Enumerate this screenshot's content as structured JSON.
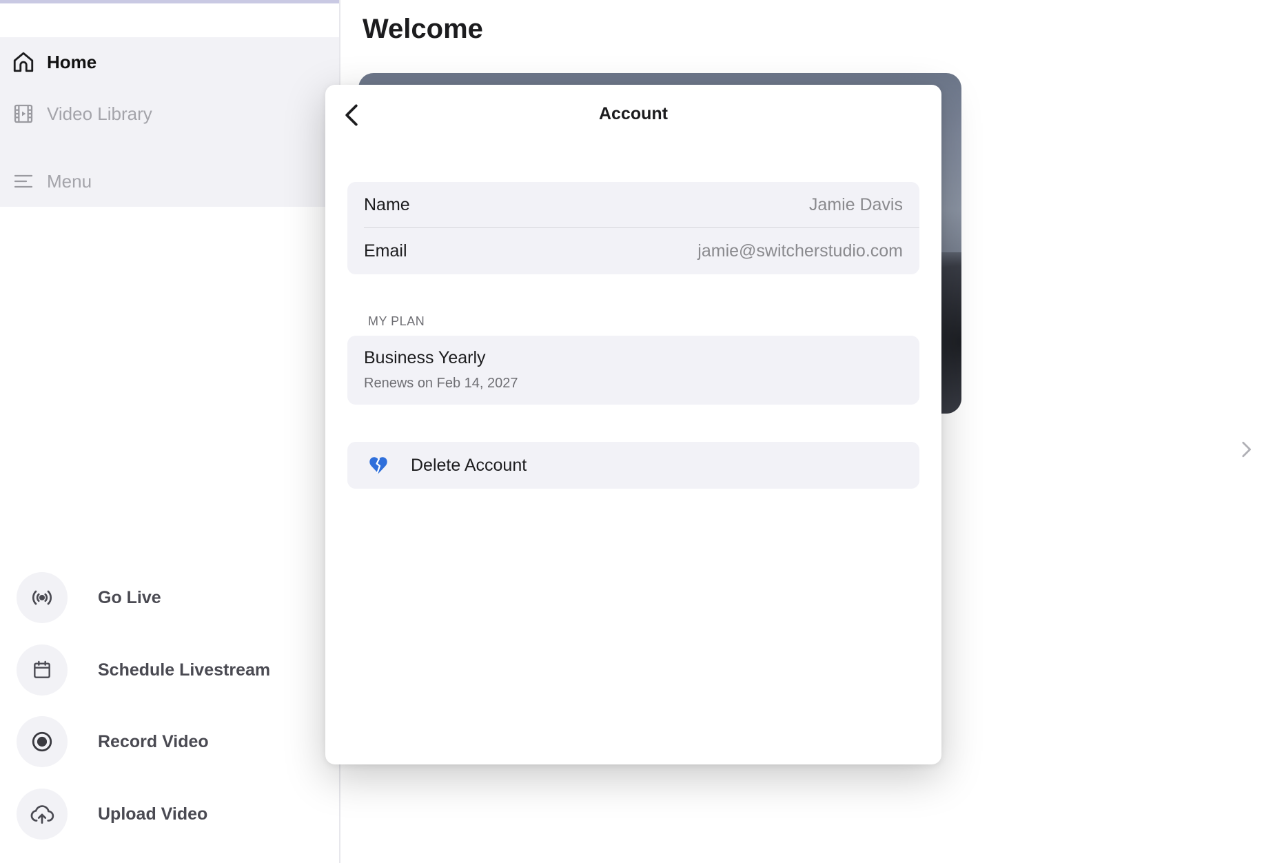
{
  "sidebar": {
    "nav": [
      {
        "label": "Home",
        "icon": "home-icon"
      },
      {
        "label": "Video Library",
        "icon": "film-icon"
      },
      {
        "label": "Menu",
        "icon": "menu-icon"
      }
    ],
    "actions": [
      {
        "label": "Go Live",
        "icon": "broadcast-icon"
      },
      {
        "label": "Schedule Livestream",
        "icon": "calendar-icon"
      },
      {
        "label": "Record Video",
        "icon": "record-icon"
      },
      {
        "label": "Upload Video",
        "icon": "cloud-upload-icon"
      }
    ]
  },
  "main": {
    "title": "Welcome"
  },
  "account_modal": {
    "title": "Account",
    "fields": [
      {
        "label": "Name",
        "value": "Jamie Davis"
      },
      {
        "label": "Email",
        "value": "jamie@switcherstudio.com"
      }
    ],
    "plan_section_label": "MY PLAN",
    "plan": {
      "name": "Business Yearly",
      "renewal": "Renews on Feb 14, 2027"
    },
    "delete_label": "Delete Account"
  },
  "colors": {
    "accent": "#2f6fdb",
    "sidebar_bg": "#f2f2f6",
    "group_bg": "#f2f2f7"
  }
}
